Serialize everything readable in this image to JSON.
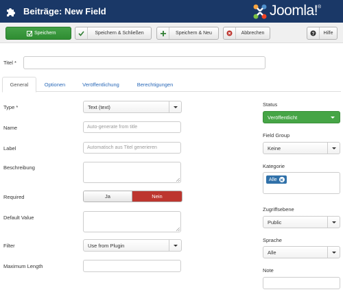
{
  "header": {
    "title": "Beiträge: New Field",
    "logo_text": "Joomla!",
    "logo_trademark": "®"
  },
  "toolbar": {
    "save_label": "Speichern",
    "save_close_label": "Speichern & Schließen",
    "save_new_label": "Speichern & Neu",
    "cancel_label": "Abbrechen",
    "help_label": "Hilfe"
  },
  "title_field": {
    "label": "Titel *",
    "value": ""
  },
  "tabs": [
    {
      "label": "General",
      "active": true
    },
    {
      "label": "Optionen",
      "active": false
    },
    {
      "label": "Veröffentlichung",
      "active": false
    },
    {
      "label": "Berechtigungen",
      "active": false
    }
  ],
  "form": {
    "type": {
      "label": "Type *",
      "value": "Text (text)"
    },
    "name": {
      "label": "Name",
      "placeholder": "Auto-generate from title"
    },
    "field_label": {
      "label": "Label",
      "placeholder": "Automatisch aus Titel generieren"
    },
    "description": {
      "label": "Beschreibung"
    },
    "required": {
      "label": "Required",
      "yes": "Ja",
      "no": "Nein",
      "selected": "Nein"
    },
    "default_value": {
      "label": "Default Value"
    },
    "filter": {
      "label": "Filter",
      "value": "Use from Plugin"
    },
    "max_length": {
      "label": "Maximum Length",
      "value": ""
    }
  },
  "sidebar": {
    "status": {
      "label": "Status",
      "value": "Veröffentlicht"
    },
    "field_group": {
      "label": "Field Group",
      "value": "Keine"
    },
    "category": {
      "label": "Kategorie",
      "chip": "Alle"
    },
    "access": {
      "label": "Zugriffsebene",
      "value": "Public"
    },
    "language": {
      "label": "Sprache",
      "value": "Alle"
    },
    "note": {
      "label": "Note",
      "value": ""
    }
  },
  "colors": {
    "header_bg": "#1a3867",
    "save_green": "#2f8d32",
    "status_green": "#46a546",
    "nein_red": "#bd362f",
    "link_blue": "#2a69b8",
    "chip_blue": "#3071a9"
  },
  "icons": {
    "header": "puzzle-icon",
    "save": "save-icon",
    "save_close": "check-icon",
    "save_new": "plus-icon",
    "cancel": "cancel-icon",
    "help": "question-icon"
  }
}
